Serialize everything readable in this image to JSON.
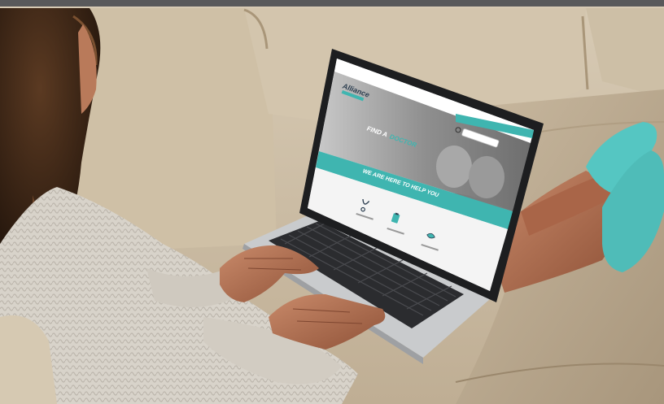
{
  "site": {
    "logo_text": "Alliance",
    "nav_items": [
      "",
      "",
      ""
    ],
    "hero_heading_part1": "FIND A",
    "hero_heading_part2": "DOCTOR",
    "search_placeholder": "",
    "banner_text": "WE ARE HERE TO HELP YOU",
    "services": [
      {
        "icon": "stethoscope-icon",
        "label": ""
      },
      {
        "icon": "clipboard-icon",
        "label": ""
      },
      {
        "icon": "handshake-icon",
        "label": ""
      }
    ]
  },
  "colors": {
    "accent_teal": "#3fb5b0",
    "sofa_leather": "#cdbfa8",
    "socks": "#55c6c2",
    "sweater": "#dcd8d0",
    "laptop_body": "#c9cbcd"
  }
}
